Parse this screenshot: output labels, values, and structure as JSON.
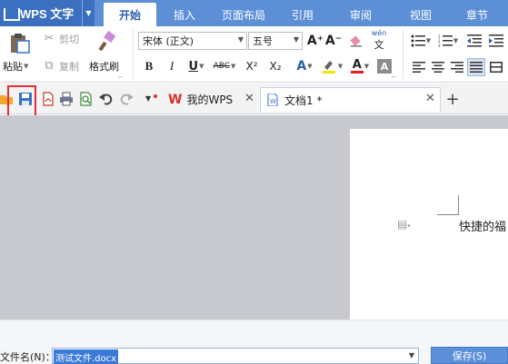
{
  "app": {
    "title": "WPS 文字",
    "menu_tabs": [
      {
        "label": "开始",
        "active": true
      },
      {
        "label": "插入",
        "active": false
      },
      {
        "label": "页面布局",
        "active": false
      },
      {
        "label": "引用",
        "active": false
      },
      {
        "label": "审阅",
        "active": false
      },
      {
        "label": "视图",
        "active": false
      },
      {
        "label": "章节",
        "active": false
      }
    ]
  },
  "ribbon": {
    "paste_label": "粘贴",
    "cut_label": "剪切",
    "copy_label": "复制",
    "format_painter_label": "格式刷",
    "font_name": "宋体 (正文)",
    "font_size": "五号",
    "bold": "B",
    "italic": "I",
    "underline": "U",
    "strikethrough": "ABC",
    "superscript": "X²",
    "subscript": "X₂",
    "grow_font": "A⁺",
    "shrink_font": "A⁻",
    "font_color_letter": "A",
    "phonetic_label": "wén",
    "char_shading": "A"
  },
  "quick_access": {
    "tabs": [
      {
        "label": "我的WPS"
      },
      {
        "label": "文档1 *"
      }
    ],
    "new_tab_symbol": "+"
  },
  "document": {
    "visible_text": "快捷的福"
  },
  "save_dialog": {
    "filename_label": "文件名(N)：",
    "filename_value": "测试文件.docx",
    "save_button_label": "保存(S)"
  },
  "colors": {
    "menubar": "#5c8fd6",
    "app_button": "#3b6fbf",
    "highlight_box": "#e03232",
    "workspace": "#c7c9cf"
  }
}
